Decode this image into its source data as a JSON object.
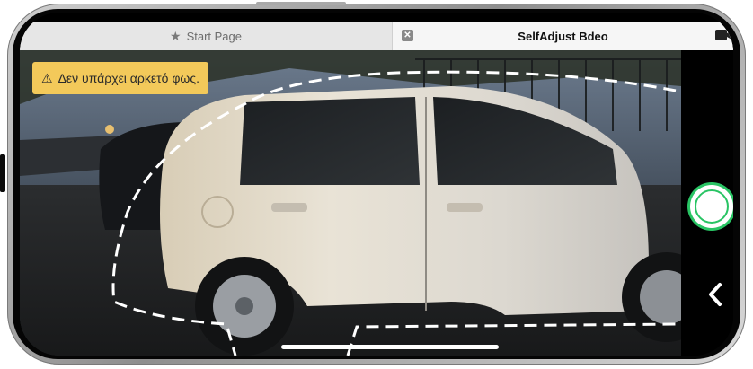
{
  "tabs": [
    {
      "label": "Start Page",
      "icon": "star-icon",
      "active": false
    },
    {
      "label": "SelfAdjust Bdeo",
      "icon": "close-icon",
      "active": true
    }
  ],
  "camera": {
    "warning_text": "Δεν υπάρχει αρκετό φως.",
    "warning_icon": "warning-triangle-icon",
    "shutter_icon": "shutter-button",
    "back_icon": "chevron-left-icon",
    "video_icon": "video-camera-icon"
  },
  "colors": {
    "warning_bg": "#f3c95a",
    "shutter_ring": "#29c464",
    "tab_bg_active": "#f6f6f6",
    "tab_bg_inactive": "#e6e6e6"
  }
}
